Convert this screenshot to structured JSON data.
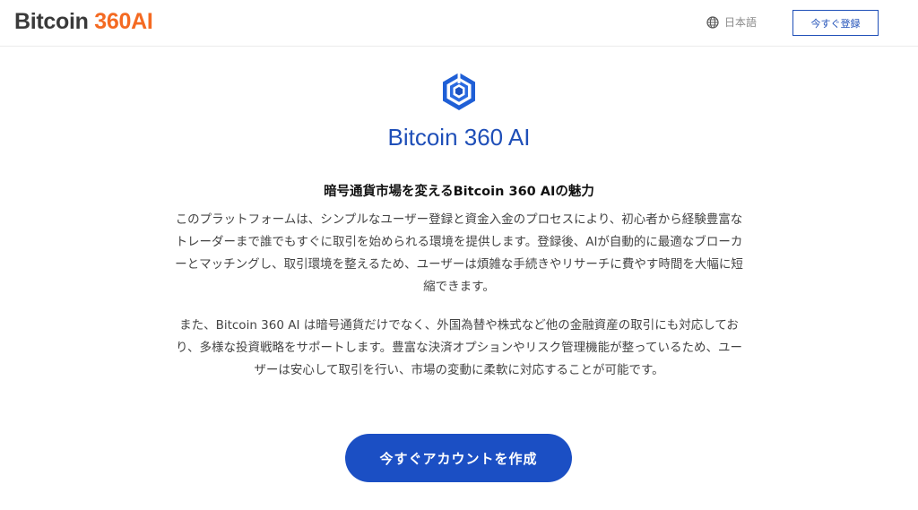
{
  "header": {
    "logo_main": "Bitcoin ",
    "logo_accent": "360AI",
    "language_label": "日本語",
    "register_label": "今すぐ登録"
  },
  "hero": {
    "brand_name": "Bitcoin 360 AI"
  },
  "content": {
    "section_title": "暗号通貨市場を変えるBitcoin 360 AIの魅力",
    "paragraph_1": "このプラットフォームは、シンプルなユーザー登録と資金入金のプロセスにより、初心者から経験豊富なトレーダーまで誰でもすぐに取引を始められる環境を提供します。登録後、AIが自動的に最適なブローカーとマッチングし、取引環境を整えるため、ユーザーは煩雑な手続きやリサーチに費やす時間を大幅に短縮できます。",
    "paragraph_2": "また、Bitcoin 360 AI は暗号通貨だけでなく、外国為替や株式など他の金融資産の取引にも対応しており、多様な投資戦略をサポートします。豊富な決済オプションやリスク管理機能が整っているため、ユーザーは安心して取引を行い、市場の変動に柔軟に対応することが可能です。"
  },
  "cta": {
    "label": "今すぐアカウントを作成"
  },
  "colors": {
    "brand_blue": "#1f4fb8",
    "accent_orange": "#f46a22",
    "cta_blue": "#1b4fc4"
  },
  "icons": {
    "language": "globe-icon",
    "brand": "hexagon-cube-logo-icon"
  }
}
